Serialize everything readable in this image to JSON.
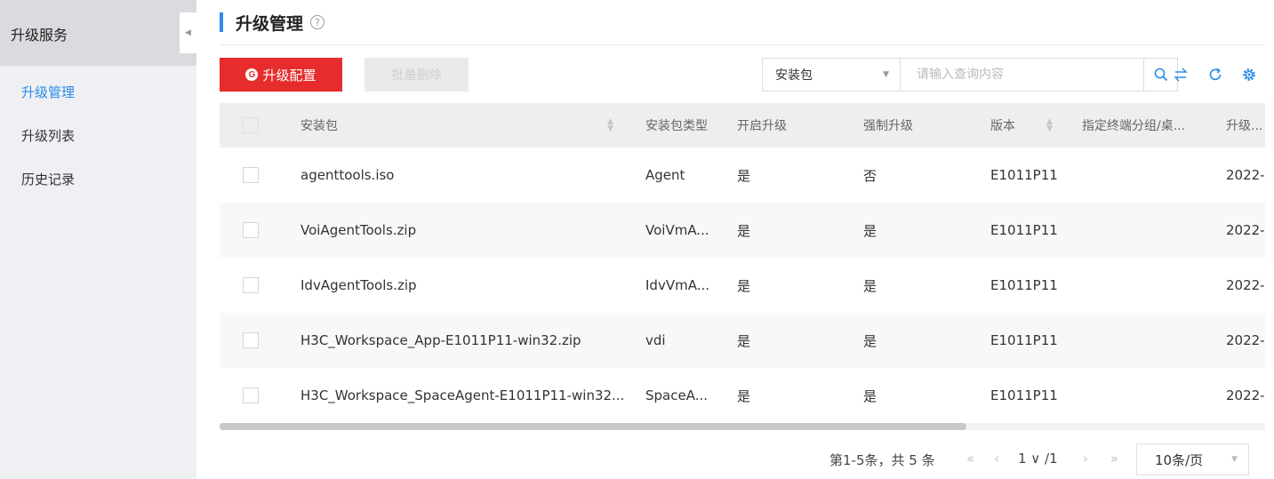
{
  "sidebar": {
    "title": "升级服务",
    "items": [
      {
        "label": "升级管理",
        "active": true
      },
      {
        "label": "升级列表",
        "active": false
      },
      {
        "label": "历史记录",
        "active": false
      }
    ]
  },
  "header": {
    "title": "升级管理",
    "help": "?"
  },
  "toolbar": {
    "upgrade_config_label": "升级配置",
    "batch_delete_label": "批量删除",
    "search_field": "安装包",
    "search_placeholder": "请输入查询内容"
  },
  "table": {
    "columns": [
      "安装包",
      "安装包类型",
      "开启升级",
      "强制升级",
      "版本",
      "指定终端分组/桌...",
      "升级..."
    ],
    "rows": [
      [
        "agenttools.iso",
        "Agent",
        "是",
        "否",
        "E1011P11",
        "",
        "2022-"
      ],
      [
        "VoiAgentTools.zip",
        "VoiVmA...",
        "是",
        "是",
        "E1011P11",
        "",
        "2022-"
      ],
      [
        "IdvAgentTools.zip",
        "IdvVmA...",
        "是",
        "是",
        "E1011P11",
        "",
        "2022-"
      ],
      [
        "H3C_Workspace_App-E1011P11-win32.zip",
        "vdi",
        "是",
        "是",
        "E1011P11",
        "",
        "2022-"
      ],
      [
        "H3C_Workspace_SpaceAgent-E1011P11-win32...",
        "SpaceA...",
        "是",
        "是",
        "E1011P11",
        "",
        "2022-"
      ]
    ]
  },
  "pagination": {
    "info": "第1-5条，共 5 条",
    "first": "«",
    "prev": "‹",
    "page": "1 ∨ /1",
    "next": "›",
    "last": "»",
    "page_size": "10条/页"
  },
  "colors": {
    "accent": "#2b8be8",
    "primary_button": "#e62c2c"
  },
  "icons": [
    "collapse-icon",
    "help-icon",
    "gear-icon",
    "search-icon",
    "transfer-icon",
    "refresh-icon",
    "settings-icon",
    "caret-down-icon",
    "sort-icon"
  ]
}
